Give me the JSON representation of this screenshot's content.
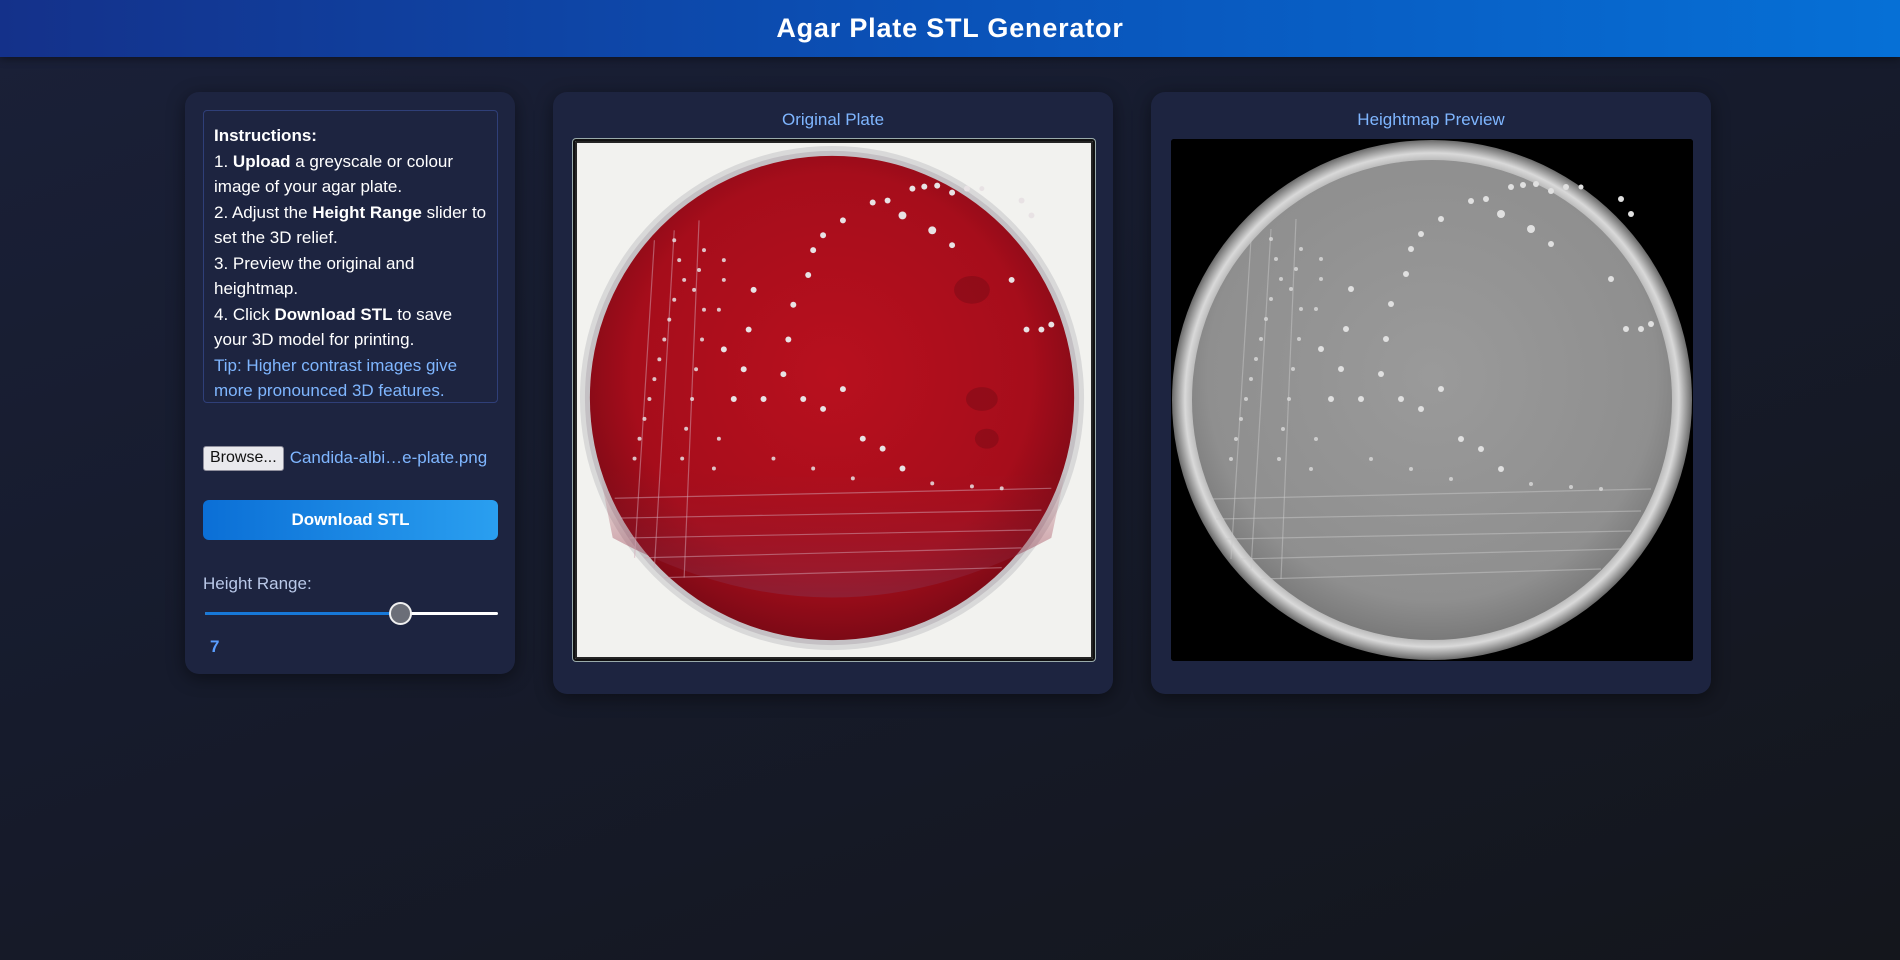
{
  "header": {
    "title": "Agar Plate STL Generator"
  },
  "instructions": {
    "heading": "Instructions:",
    "step1_num": "1.",
    "step1_bold": "Upload",
    "step1_rest": " a greyscale or colour image of your agar plate.",
    "step2_num": "2. Adjust the",
    "step2_bold": "Height Range",
    "step2_rest": " slider to set the 3D relief.",
    "step3": "3. Preview the original and heightmap.",
    "step4_num": "4. Click",
    "step4_bold": "Download STL",
    "step4_rest": " to save your 3D model for printing.",
    "tip": "Tip: Higher contrast images give more pronounced 3D features."
  },
  "file_input": {
    "button_label": "Browse...",
    "file_name": "Candida-albi…e-plate.png"
  },
  "download_button": {
    "label": "Download STL"
  },
  "height_range": {
    "label": "Height Range:",
    "value": "7",
    "min": 1,
    "max": 10,
    "fraction": 0.667
  },
  "panels": {
    "original": {
      "title": "Original Plate"
    },
    "heightmap": {
      "title": "Heightmap Preview"
    }
  },
  "colors": {
    "accent": "#1778d8",
    "header_start": "#14318a",
    "header_end": "#0670d6",
    "card_bg": "#1d2440",
    "link_text": "#7fb6ff",
    "agar_red": "#b30f1f"
  }
}
